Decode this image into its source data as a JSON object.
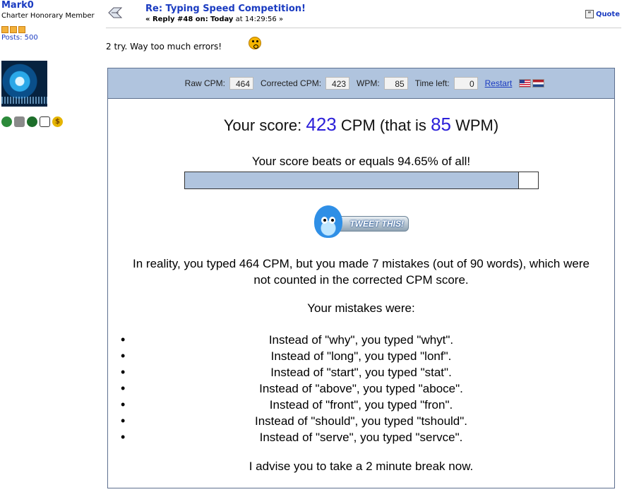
{
  "user": {
    "name": "Mark0",
    "title": "Charter Honorary Member",
    "posts": "Posts: 500",
    "star_count": 3
  },
  "post": {
    "subject": "Re: Typing Speed Competition!",
    "reply_prefix": "« Reply #48 on:",
    "date": "Today",
    "time": "at 14:29:56 »",
    "quote_label": "Quote",
    "body": "2 try. Way too much errors!"
  },
  "stats": {
    "raw_label": "Raw CPM:",
    "raw_value": "464",
    "corrected_label": "Corrected CPM:",
    "corrected_value": "423",
    "wpm_label": "WPM:",
    "wpm_value": "85",
    "time_label": "Time left:",
    "time_value": "0",
    "restart_label": "Restart"
  },
  "result": {
    "score_prefix": "Your score:",
    "score_cpm": "423",
    "score_mid": "CPM (that is",
    "score_wpm": "85",
    "score_suffix": "WPM)",
    "beats_text": "Your score beats or equals 94.65% of all!",
    "beats_fraction": 0.9465,
    "tweet_label": "TWEET THIS!",
    "reality_line1": "In reality, you typed 464 CPM, but you made 7 mistakes (out of 90 words), which were",
    "reality_line2": "not counted in the corrected CPM score.",
    "mistakes_title": "Your mistakes were:",
    "mistakes": [
      "Instead of \"why\", you typed \"whyt\".",
      "Instead of \"long\", you typed \"lonf\".",
      "Instead of \"start\", you typed \"stat\".",
      "Instead of \"above\", you typed \"aboce\".",
      "Instead of \"front\", you typed \"fron\".",
      "Instead of \"should\", you typed \"tshould\".",
      "Instead of \"serve\", you typed \"servce\"."
    ],
    "advice": "I advise you to take a 2 minute break now."
  },
  "colors": {
    "link": "#1a3bc1",
    "stats_bar": "#b0c4de",
    "score_number": "#2c20d9"
  }
}
